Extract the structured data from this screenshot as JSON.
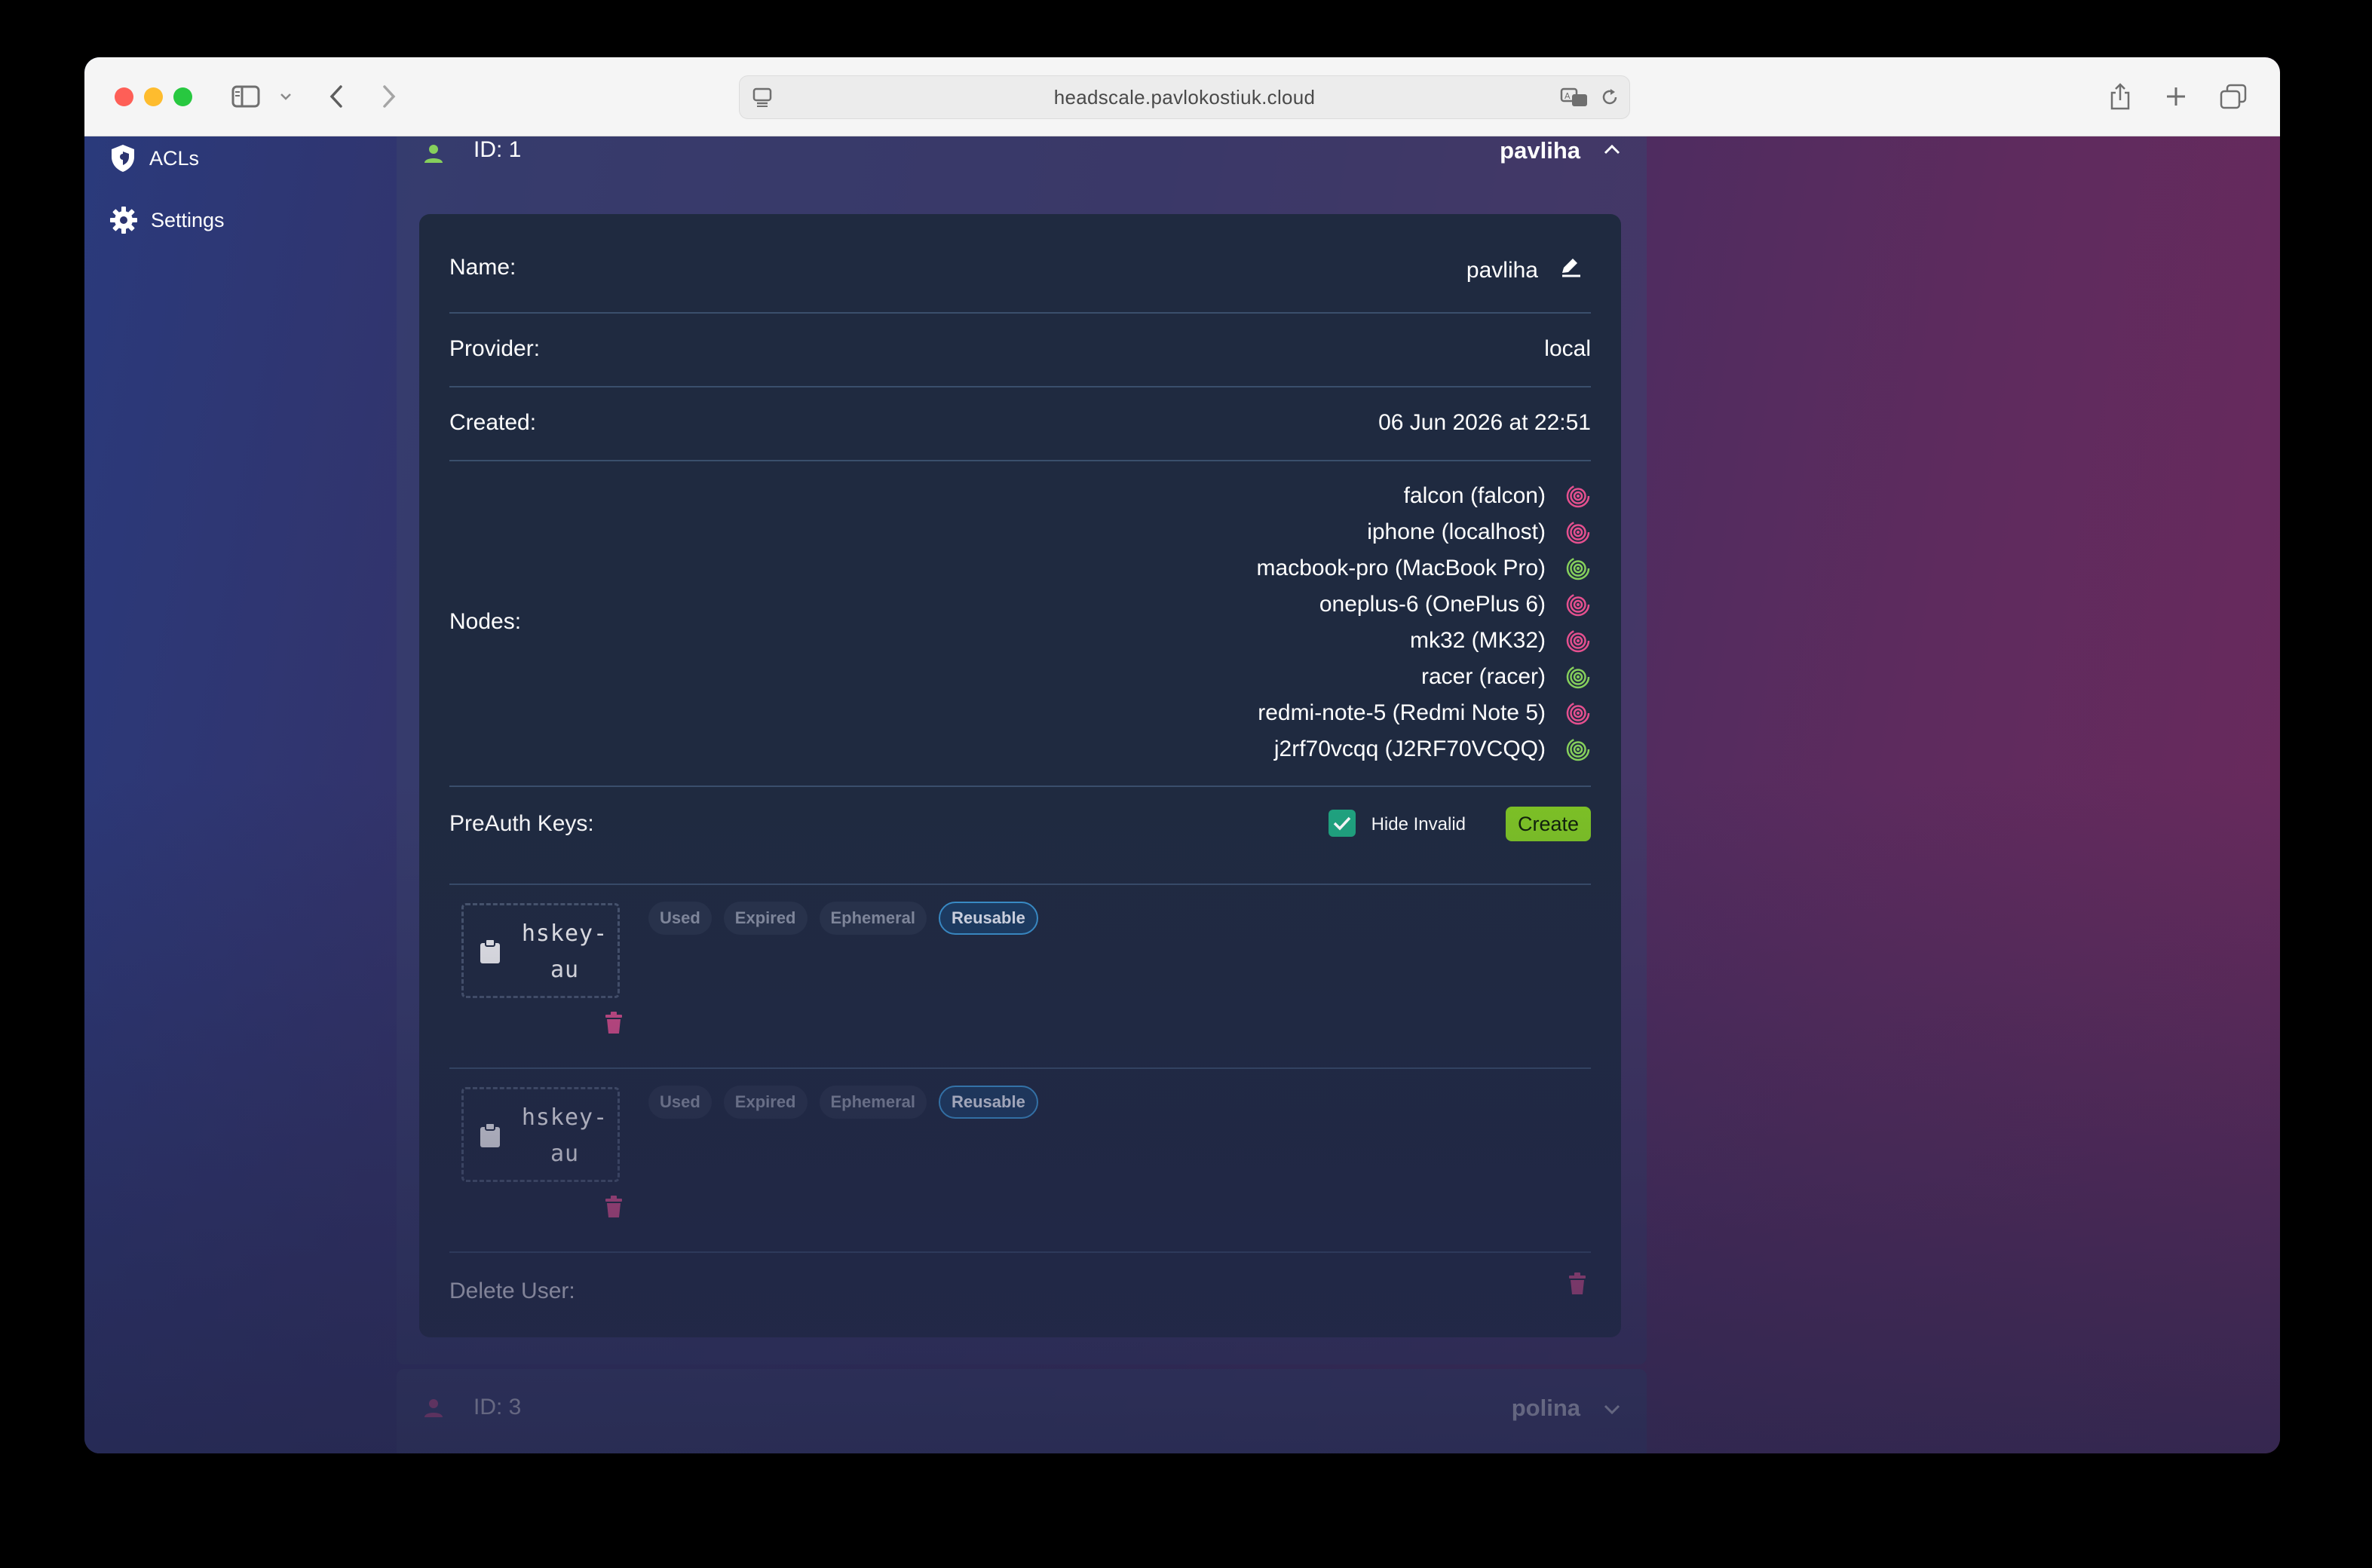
{
  "browser": {
    "url": "headscale.pavlokostiuk.cloud"
  },
  "sidebar": {
    "items": [
      {
        "label": "ACLs",
        "icon": "shield-icon"
      },
      {
        "label": "Settings",
        "icon": "gear-icon"
      }
    ]
  },
  "user_expanded": {
    "id_label": "ID: 1",
    "username": "pavliha",
    "status_color": "#86d05c",
    "details": {
      "name_label": "Name:",
      "name_value": "pavliha",
      "provider_label": "Provider:",
      "provider_value": "local",
      "created_label": "Created:",
      "created_value": "06 Jun 2026 at 22:51",
      "nodes_label": "Nodes:",
      "nodes": [
        {
          "label": "falcon (falcon)",
          "online": false
        },
        {
          "label": "iphone (localhost)",
          "online": false
        },
        {
          "label": "macbook-pro (MacBook Pro)",
          "online": true
        },
        {
          "label": "oneplus-6 (OnePlus 6)",
          "online": false
        },
        {
          "label": "mk32 (MK32)",
          "online": false
        },
        {
          "label": "racer (racer)",
          "online": true
        },
        {
          "label": "redmi-note-5 (Redmi Note 5)",
          "online": false
        },
        {
          "label": "j2rf70vcqq (J2RF70VCQQ)",
          "online": true
        }
      ],
      "preauth_label": "PreAuth Keys:",
      "hide_invalid_label": "Hide Invalid",
      "hide_invalid_checked": true,
      "create_label": "Create",
      "keys": [
        {
          "line1": "hskey-",
          "line2": "au",
          "tags": [
            "Used",
            "Expired",
            "Ephemeral",
            "Reusable"
          ],
          "active_tag": "Reusable"
        },
        {
          "line1": "hskey-",
          "line2": "au",
          "tags": [
            "Used",
            "Expired",
            "Ephemeral",
            "Reusable"
          ],
          "active_tag": "Reusable"
        }
      ],
      "delete_label": "Delete User:"
    }
  },
  "user_collapsed": {
    "id_label": "ID: 3",
    "username": "polina",
    "status_color": "#e5508f"
  },
  "colors": {
    "online": "#86d05c",
    "offline": "#e5508f",
    "danger": "#e5508f",
    "create": "#7fc525"
  }
}
